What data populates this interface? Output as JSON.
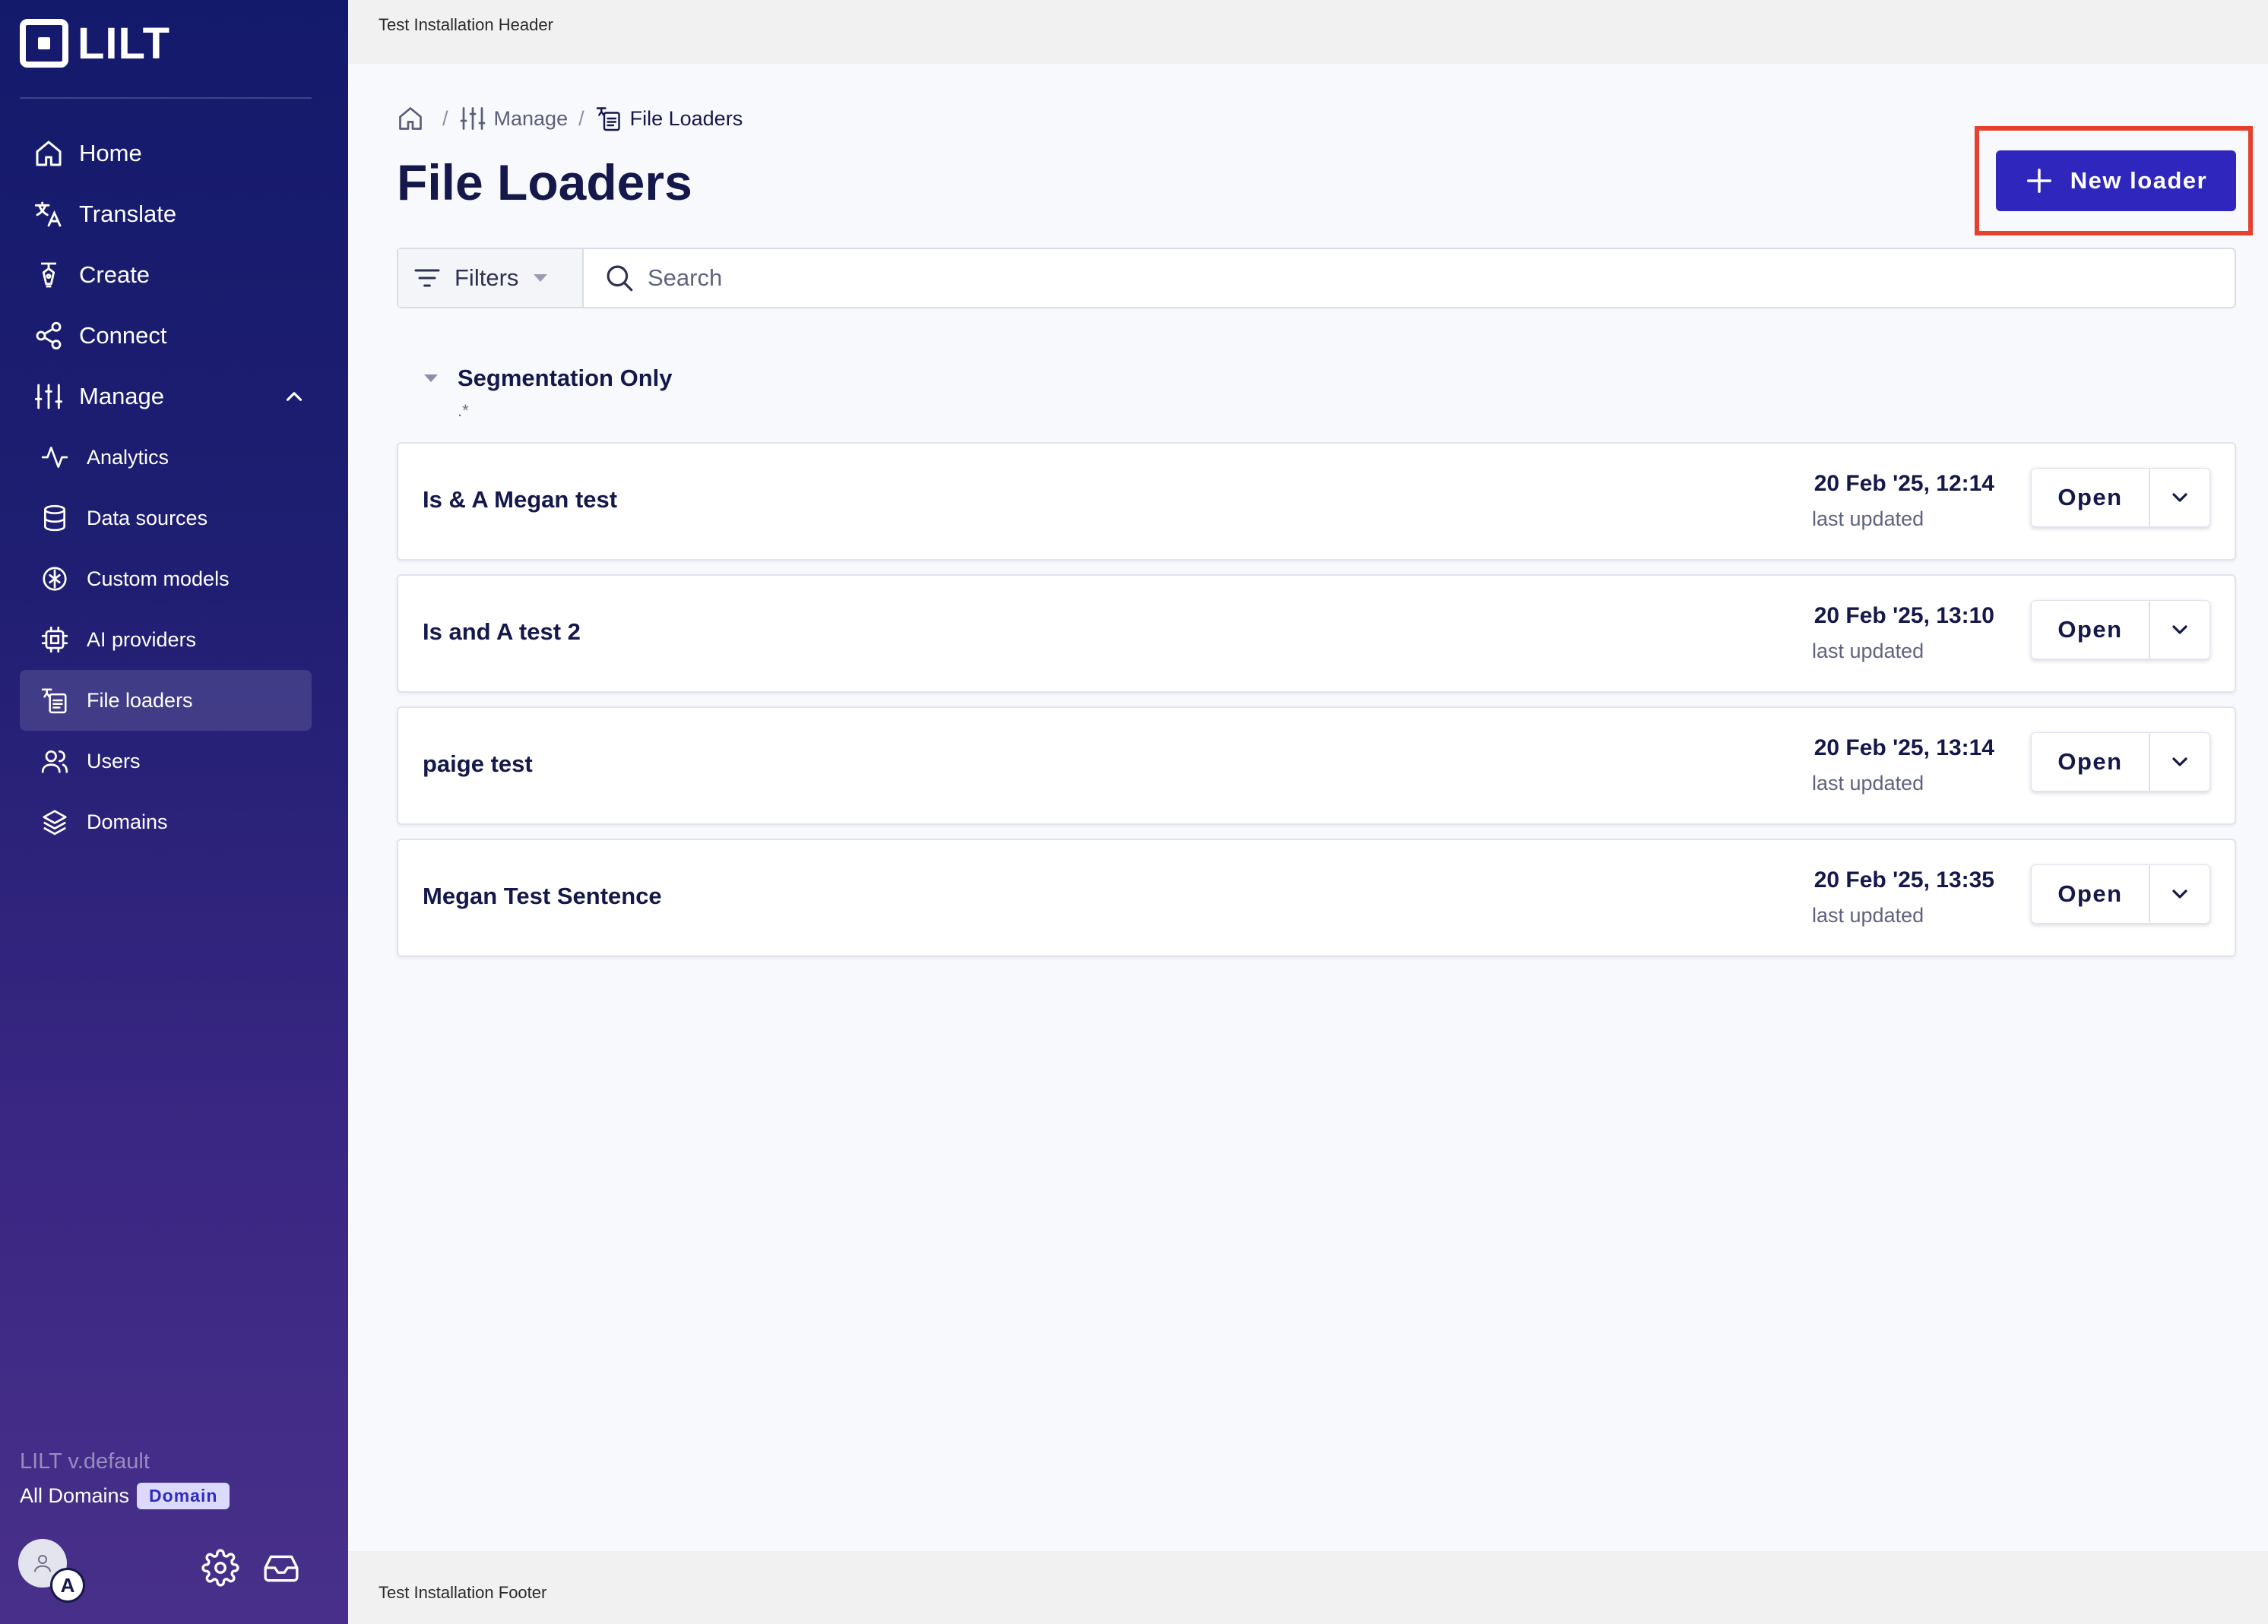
{
  "app": {
    "logo_text": "LILT"
  },
  "sidebar": {
    "items": [
      {
        "label": "Home",
        "icon": "home-icon"
      },
      {
        "label": "Translate",
        "icon": "translate-icon"
      },
      {
        "label": "Create",
        "icon": "pen-icon"
      },
      {
        "label": "Connect",
        "icon": "share-icon"
      },
      {
        "label": "Manage",
        "icon": "sliders-icon",
        "expanded": true
      }
    ],
    "sub_items": [
      {
        "label": "Analytics",
        "icon": "activity-icon"
      },
      {
        "label": "Data sources",
        "icon": "database-icon"
      },
      {
        "label": "Custom models",
        "icon": "model-icon"
      },
      {
        "label": "AI providers",
        "icon": "chip-icon"
      },
      {
        "label": "File loaders",
        "icon": "file-loader-icon",
        "active": true
      },
      {
        "label": "Users",
        "icon": "users-icon"
      },
      {
        "label": "Domains",
        "icon": "layers-icon"
      }
    ],
    "version": "LILT v.default",
    "domain_scope": "All Domains",
    "domain_badge": "Domain",
    "avatar_initial": "A"
  },
  "install_header": "Test Installation Header",
  "install_footer": "Test Installation Footer",
  "breadcrumb": {
    "manage": "Manage",
    "current": "File Loaders"
  },
  "page_title": "File Loaders",
  "new_button_label": "New loader",
  "toolbar": {
    "filters_label": "Filters",
    "search_placeholder": "Search"
  },
  "group": {
    "title": "Segmentation Only",
    "pattern": ".*"
  },
  "loaders": [
    {
      "name": "Is & A Megan test",
      "date": "20 Feb '25, 12:14",
      "updated_label": "last updated",
      "open_label": "Open"
    },
    {
      "name": "Is and A test 2",
      "date": "20 Feb '25, 13:10",
      "updated_label": "last updated",
      "open_label": "Open"
    },
    {
      "name": "paige test",
      "date": "20 Feb '25, 13:14",
      "updated_label": "last updated",
      "open_label": "Open"
    },
    {
      "name": "Megan Test Sentence",
      "date": "20 Feb '25, 13:35",
      "updated_label": "last updated",
      "open_label": "Open"
    }
  ],
  "colors": {
    "primary": "#2f26be",
    "highlight": "#e6402e",
    "text": "#14184a",
    "sidebar_top": "#141a6b",
    "sidebar_bottom": "#48308a"
  }
}
